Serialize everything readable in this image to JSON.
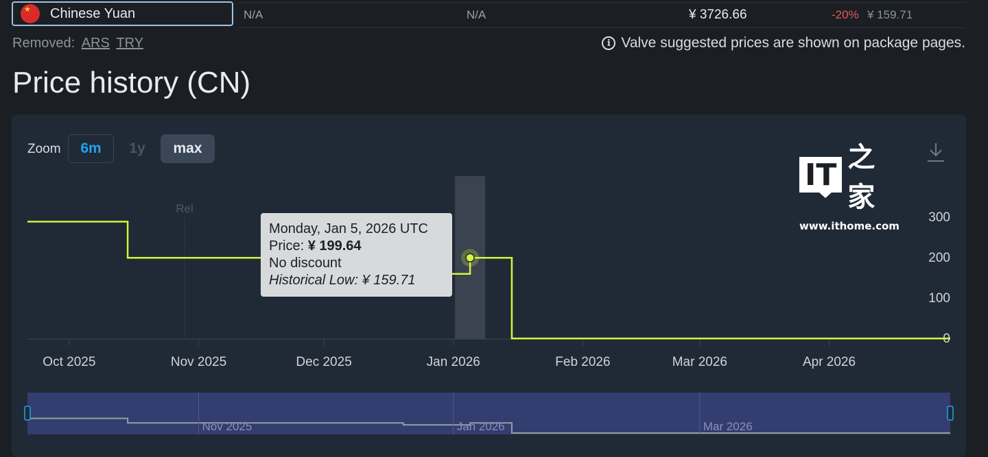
{
  "currency_row": {
    "flag_icon": "china-flag-icon",
    "name": "Chinese Yuan",
    "col1": "N/A",
    "col2": "N/A",
    "price": "¥ 3726.66",
    "discount": "-20%",
    "discounted_price": "¥ 159.71"
  },
  "removed": {
    "label": "Removed:",
    "links": [
      "ARS",
      "TRY"
    ]
  },
  "note": "Valve suggested prices are shown on package pages.",
  "title": "Price history (CN)",
  "zoom": {
    "label": "Zoom",
    "options": [
      "6m",
      "1y",
      "max"
    ],
    "active": "max"
  },
  "logo": {
    "text_it": "IT",
    "text_home": "之家",
    "url": "www.ithome.com"
  },
  "tooltip": {
    "date": "Monday, Jan 5, 2026 UTC",
    "price_label": "Price:",
    "price_value": "¥ 199.64",
    "discount": "No discount",
    "low": "Historical Low: ¥ 159.71"
  },
  "chart_data": {
    "type": "line",
    "step": true,
    "marker": "Rel",
    "x_ticks": [
      "Oct 2025",
      "Nov 2025",
      "Dec 2025",
      "Jan 2026",
      "Feb 2026",
      "Mar 2026",
      "Apr 2026"
    ],
    "y_ticks": [
      0,
      100,
      200,
      300
    ],
    "ylim": [
      0,
      330
    ],
    "series": [
      {
        "points": [
          {
            "x": "2025-09-21",
            "y": 289
          },
          {
            "x": "2025-10-15",
            "y": 199.64
          },
          {
            "x": "2025-12-20",
            "y": 159.71
          },
          {
            "x": "2026-01-05",
            "y": 199.64
          },
          {
            "x": "2026-01-15",
            "y": 0
          },
          {
            "x": "2026-04-30",
            "y": 0
          }
        ]
      }
    ],
    "highlight": {
      "x": "2026-01-05",
      "y": 199.64
    },
    "navigator_ticks": [
      "Nov 2025",
      "Jan 2026",
      "Mar 2026"
    ],
    "colors": {
      "line": "#d4f53c",
      "navigator_line": "#8fa39a",
      "navigator_bg": "#343d70"
    }
  }
}
